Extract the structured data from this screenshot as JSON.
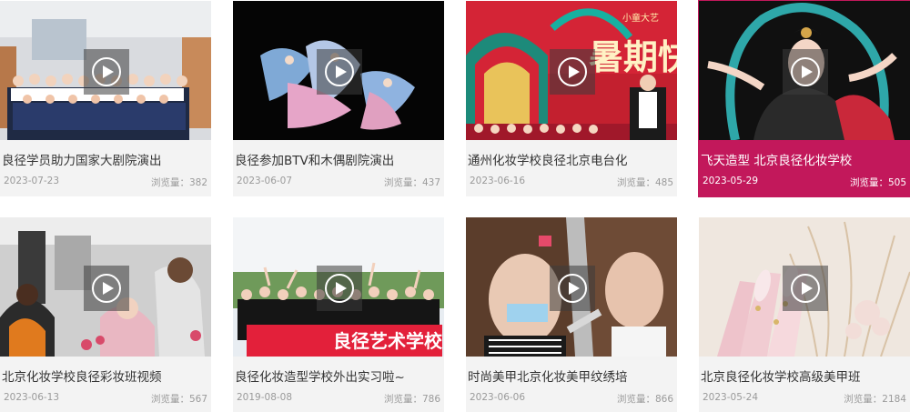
{
  "videos": [
    {
      "title": "良径学员助力国家大剧院演出",
      "date": "2023-07-23",
      "views_label": "浏览量：382",
      "active": false
    },
    {
      "title": "良径参加BTV和木偶剧院演出",
      "date": "2023-06-07",
      "views_label": "浏览量：437",
      "active": false
    },
    {
      "title": "通州化妆学校良径北京电台化",
      "date": "2023-06-16",
      "views_label": "浏览量：485",
      "active": false
    },
    {
      "title": "飞天造型 北京良径化妆学校",
      "date": "2023-05-29",
      "views_label": "浏览量：505",
      "active": true
    },
    {
      "title": "北京化妆学校良径彩妆班视频",
      "date": "2023-06-13",
      "views_label": "浏览量：567",
      "active": false
    },
    {
      "title": "良径化妆造型学校外出实习啦~",
      "date": "2019-08-08",
      "views_label": "浏览量：786",
      "active": false
    },
    {
      "title": "时尚美甲北京化妆美甲纹绣培",
      "date": "2023-06-06",
      "views_label": "浏览量：866",
      "active": false
    },
    {
      "title": "北京良径化妆学校高级美甲班",
      "date": "2023-05-24",
      "views_label": "浏览量：2184",
      "active": false
    }
  ],
  "thumb_texts": {
    "stage_sign": "小童大艺",
    "stage_big": "暑期快",
    "banner": "良径艺术学校"
  },
  "colors": {
    "active_bg": "#c2185b",
    "card_bg": "#f3f3f3",
    "meta_text": "#9a9a9a"
  },
  "icons": {
    "play": "play-circle-icon"
  }
}
